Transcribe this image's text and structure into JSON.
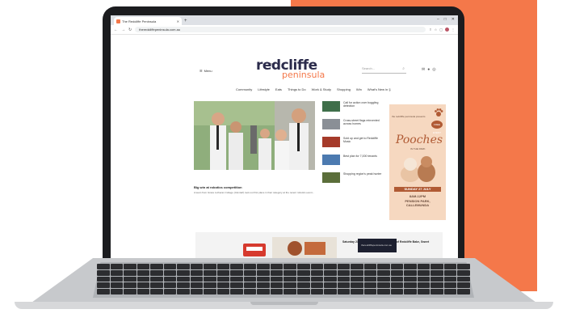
{
  "browser": {
    "tab_title": "The Redcliffe Peninsula",
    "url": "theredcliffepeninsula.com.au",
    "new_tab": "+"
  },
  "site": {
    "menu_label": "Menu",
    "logo_small": "the",
    "logo_top": "redcliffe",
    "logo_bottom": "peninsula",
    "search_placeholder": "Search...",
    "nav": [
      "Community",
      "Lifestyle",
      "Eats",
      "Things to Do",
      "Work & Study",
      "Shopping",
      "Win",
      "What's New in §"
    ],
    "hero_caption": "Big win at robotics competition",
    "hero_desc": "A team from Grace Lutheran College (Clontarf) took out first place in their category at the recent robotics event...",
    "stories": [
      {
        "title": "Call for action over boggling detection",
        "color": "#3f6f4a"
      },
      {
        "title": "Cross-street flags reinvented across homes",
        "color": "#8a8f96"
      },
      {
        "title": "Sold up and get to Redcliffe Music",
        "color": "#a53a2a"
      },
      {
        "title": "Best plan for 7,000 tenants",
        "color": "#4c7ab0"
      },
      {
        "title": "Shopping region's peak hunter",
        "color": "#5b6e3a"
      }
    ]
  },
  "ad": {
    "small_text": "the redcliffe peninsula presents",
    "free_badge": "FREE EVENT",
    "title": "Pooches",
    "subtitle": "IN THE PARK",
    "date": "SUNDAY 27 JULY",
    "time": "8AM-12PM",
    "location": "PENSION PARK, CALLEMUNDA"
  },
  "banner": {
    "text": "Saturday 23rd July 5-8pm 7:30pm Taste of Redcliffe Bake, Sweet",
    "dark_text": "theredcliffepeninsula.com.au"
  },
  "colors": {
    "accent": "#f4784a",
    "logo_dark": "#2b2b4b"
  }
}
